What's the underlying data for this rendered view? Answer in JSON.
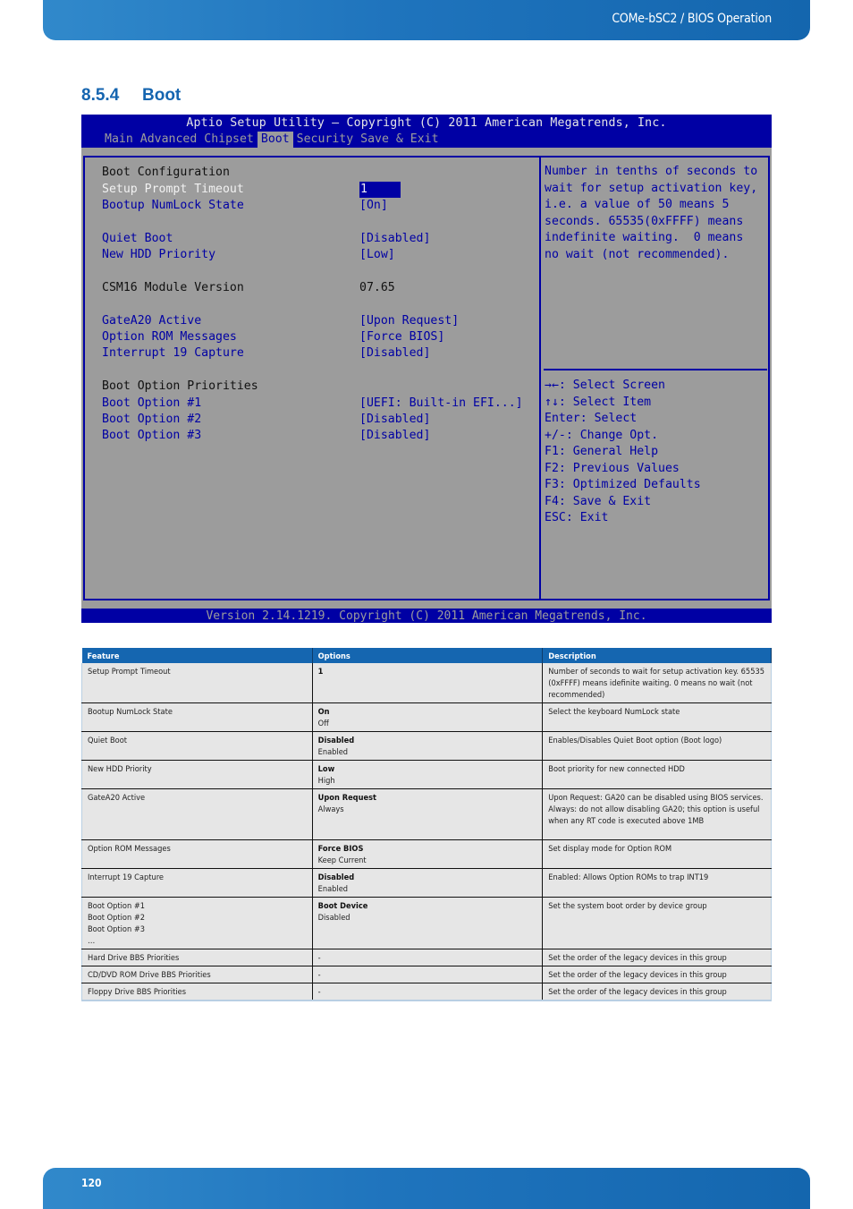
{
  "header": {
    "title": "COMe-bSC2 / BIOS Operation"
  },
  "section": {
    "number": "8.5.4",
    "title": "Boot"
  },
  "bios": {
    "title": "Aptio Setup Utility – Copyright (C) 2011 American Megatrends, Inc.",
    "tabs": [
      {
        "label": "Main",
        "active": false
      },
      {
        "label": "Advanced",
        "active": false
      },
      {
        "label": "Chipset",
        "active": false
      },
      {
        "label": "Boot",
        "active": true
      },
      {
        "label": "Security",
        "active": false
      },
      {
        "label": "Save & Exit",
        "active": false
      }
    ],
    "rows": [
      {
        "label": "Boot Configuration",
        "value": "",
        "type": "header"
      },
      {
        "label": "Setup Prompt Timeout",
        "value": "1",
        "type": "selected"
      },
      {
        "label": "Bootup NumLock State",
        "value": "[On]",
        "type": "option"
      },
      {
        "label": "Quiet Boot",
        "value": "[Disabled]",
        "type": "option"
      },
      {
        "label": "New HDD Priority",
        "value": "[Low]",
        "type": "option"
      },
      {
        "label": "CSM16 Module Version",
        "value": "07.65",
        "type": "info"
      },
      {
        "label": "GateA20 Active",
        "value": "[Upon Request]",
        "type": "option"
      },
      {
        "label": "Option ROM Messages",
        "value": "[Force BIOS]",
        "type": "option"
      },
      {
        "label": "Interrupt 19 Capture",
        "value": "[Disabled]",
        "type": "option"
      },
      {
        "label": "Boot Option Priorities",
        "value": "",
        "type": "header"
      },
      {
        "label": "Boot Option #1",
        "value": "[UEFI: Built-in EFI...]",
        "type": "option"
      },
      {
        "label": "Boot Option #2",
        "value": "[Disabled]",
        "type": "option"
      },
      {
        "label": "Boot Option #3",
        "value": "[Disabled]",
        "type": "option"
      }
    ],
    "help_lines": [
      "Number in tenths of seconds to",
      "wait for setup activation key,",
      "i.e. a value of 50 means 5",
      "seconds. 65535(0xFFFF) means",
      "indefinite waiting.  0 means",
      "no wait (not recommended)."
    ],
    "keys": [
      "→←: Select Screen",
      "↑↓: Select Item",
      "Enter: Select",
      "+/-: Change Opt.",
      "F1: General Help",
      "F2: Previous Values",
      "F3: Optimized Defaults",
      "F4: Save & Exit",
      "ESC: Exit"
    ],
    "footer": "Version 2.14.1219. Copyright (C) 2011 American Megatrends, Inc."
  },
  "table": {
    "headers": [
      "Feature",
      "Options",
      "Description"
    ],
    "rows": [
      {
        "feature": [
          "Setup Prompt Timeout"
        ],
        "default": "1",
        "others": [],
        "description": "Number of seconds to wait for setup activation key. 65535 (0xFFFF) means idefinite waiting. 0 means no wait (not recommended)"
      },
      {
        "feature": [
          "Bootup NumLock State"
        ],
        "default": "On",
        "others": [
          "Off"
        ],
        "description": "Select the keyboard NumLock state"
      },
      {
        "feature": [
          "Quiet Boot"
        ],
        "default": "Disabled",
        "others": [
          "Enabled"
        ],
        "description": "Enables/Disables Quiet Boot option (Boot logo)"
      },
      {
        "feature": [
          "New HDD Priority"
        ],
        "default": "Low",
        "others": [
          "High"
        ],
        "description": "Boot priority for new connected HDD"
      },
      {
        "feature": [
          "GateA20 Active"
        ],
        "default": "Upon Request",
        "others": [
          "Always"
        ],
        "description": "Upon Request: GA20 can be disabled using BIOS services. Always: do not allow disabling GA20; this option is useful when any RT code is executed above 1MB"
      },
      {
        "feature": [
          "Option ROM Messages"
        ],
        "default": "Force BIOS",
        "others": [
          "Keep Current"
        ],
        "description": "Set display mode for Option ROM"
      },
      {
        "feature": [
          "Interrupt 19 Capture"
        ],
        "default": "Disabled",
        "others": [
          "Enabled"
        ],
        "description": "Enabled: Allows Option ROMs to trap INT19"
      },
      {
        "feature": [
          "Boot Option #1",
          "Boot Option #2",
          "Boot Option #3",
          "…"
        ],
        "default": "Boot Device",
        "others": [
          "Disabled"
        ],
        "description": "Set the system boot order by device group"
      },
      {
        "feature": [
          "Hard Drive BBS Priorities"
        ],
        "default": "",
        "others": [
          "-"
        ],
        "description": "Set the order of the legacy devices in this group"
      },
      {
        "feature": [
          "CD/DVD ROM Drive BBS Priorities"
        ],
        "default": "",
        "others": [
          "-"
        ],
        "description": "Set the order of the legacy devices in this group"
      },
      {
        "feature": [
          "Floppy Drive BBS Priorities"
        ],
        "default": "",
        "others": [
          "-"
        ],
        "description": "Set the order of the legacy devices in this group"
      }
    ]
  },
  "footer": {
    "page_number": "120"
  }
}
